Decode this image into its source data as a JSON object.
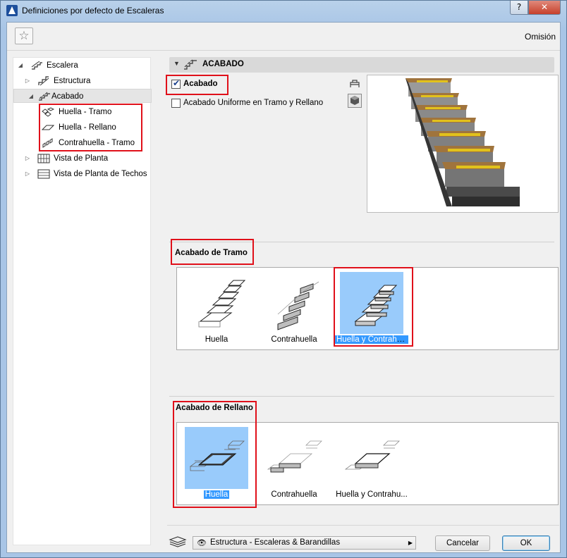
{
  "window": {
    "title": "Definiciones por defecto de Escaleras",
    "help_label": "?",
    "close_label": "✕"
  },
  "toolbar": {
    "favorites_label": "☆",
    "omision_label": "Omisión"
  },
  "tree": [
    {
      "label": "Escalera",
      "expanded": true
    },
    {
      "label": "Estructura",
      "expanded": false
    },
    {
      "label": "Acabado",
      "expanded": true,
      "selected": true
    },
    {
      "label": "Huella - Tramo"
    },
    {
      "label": "Huella - Rellano"
    },
    {
      "label": "Contrahuella - Tramo"
    },
    {
      "label": "Vista de Planta",
      "expanded": false
    },
    {
      "label": "Vista de Planta de Techos",
      "expanded": false
    }
  ],
  "section": {
    "title": "ACABADO"
  },
  "acabado_checkbox": {
    "label": "Acabado",
    "checked": true
  },
  "uniforme_checkbox": {
    "label": "Acabado Uniforme en Tramo y Rellano",
    "checked": false
  },
  "tramo": {
    "label": "Acabado de Tramo",
    "options": [
      {
        "label": "Huella",
        "selected": false
      },
      {
        "label": "Contrahuella",
        "selected": false
      },
      {
        "label": "Huella y Contrahu...",
        "selected": true
      }
    ]
  },
  "rellano": {
    "label": "Acabado de Rellano",
    "options": [
      {
        "label": "Huella",
        "selected": true
      },
      {
        "label": "Contrahuella",
        "selected": false
      },
      {
        "label": "Huella y Contrahu...",
        "selected": false
      }
    ]
  },
  "footer": {
    "layer_value": "Estructura - Escaleras & Barandillas",
    "cancel_label": "Cancelar",
    "ok_label": "OK"
  },
  "colors": {
    "highlight": "#e0101a",
    "selection": "#99cbfb",
    "selection_text_bg": "#3399ff"
  }
}
